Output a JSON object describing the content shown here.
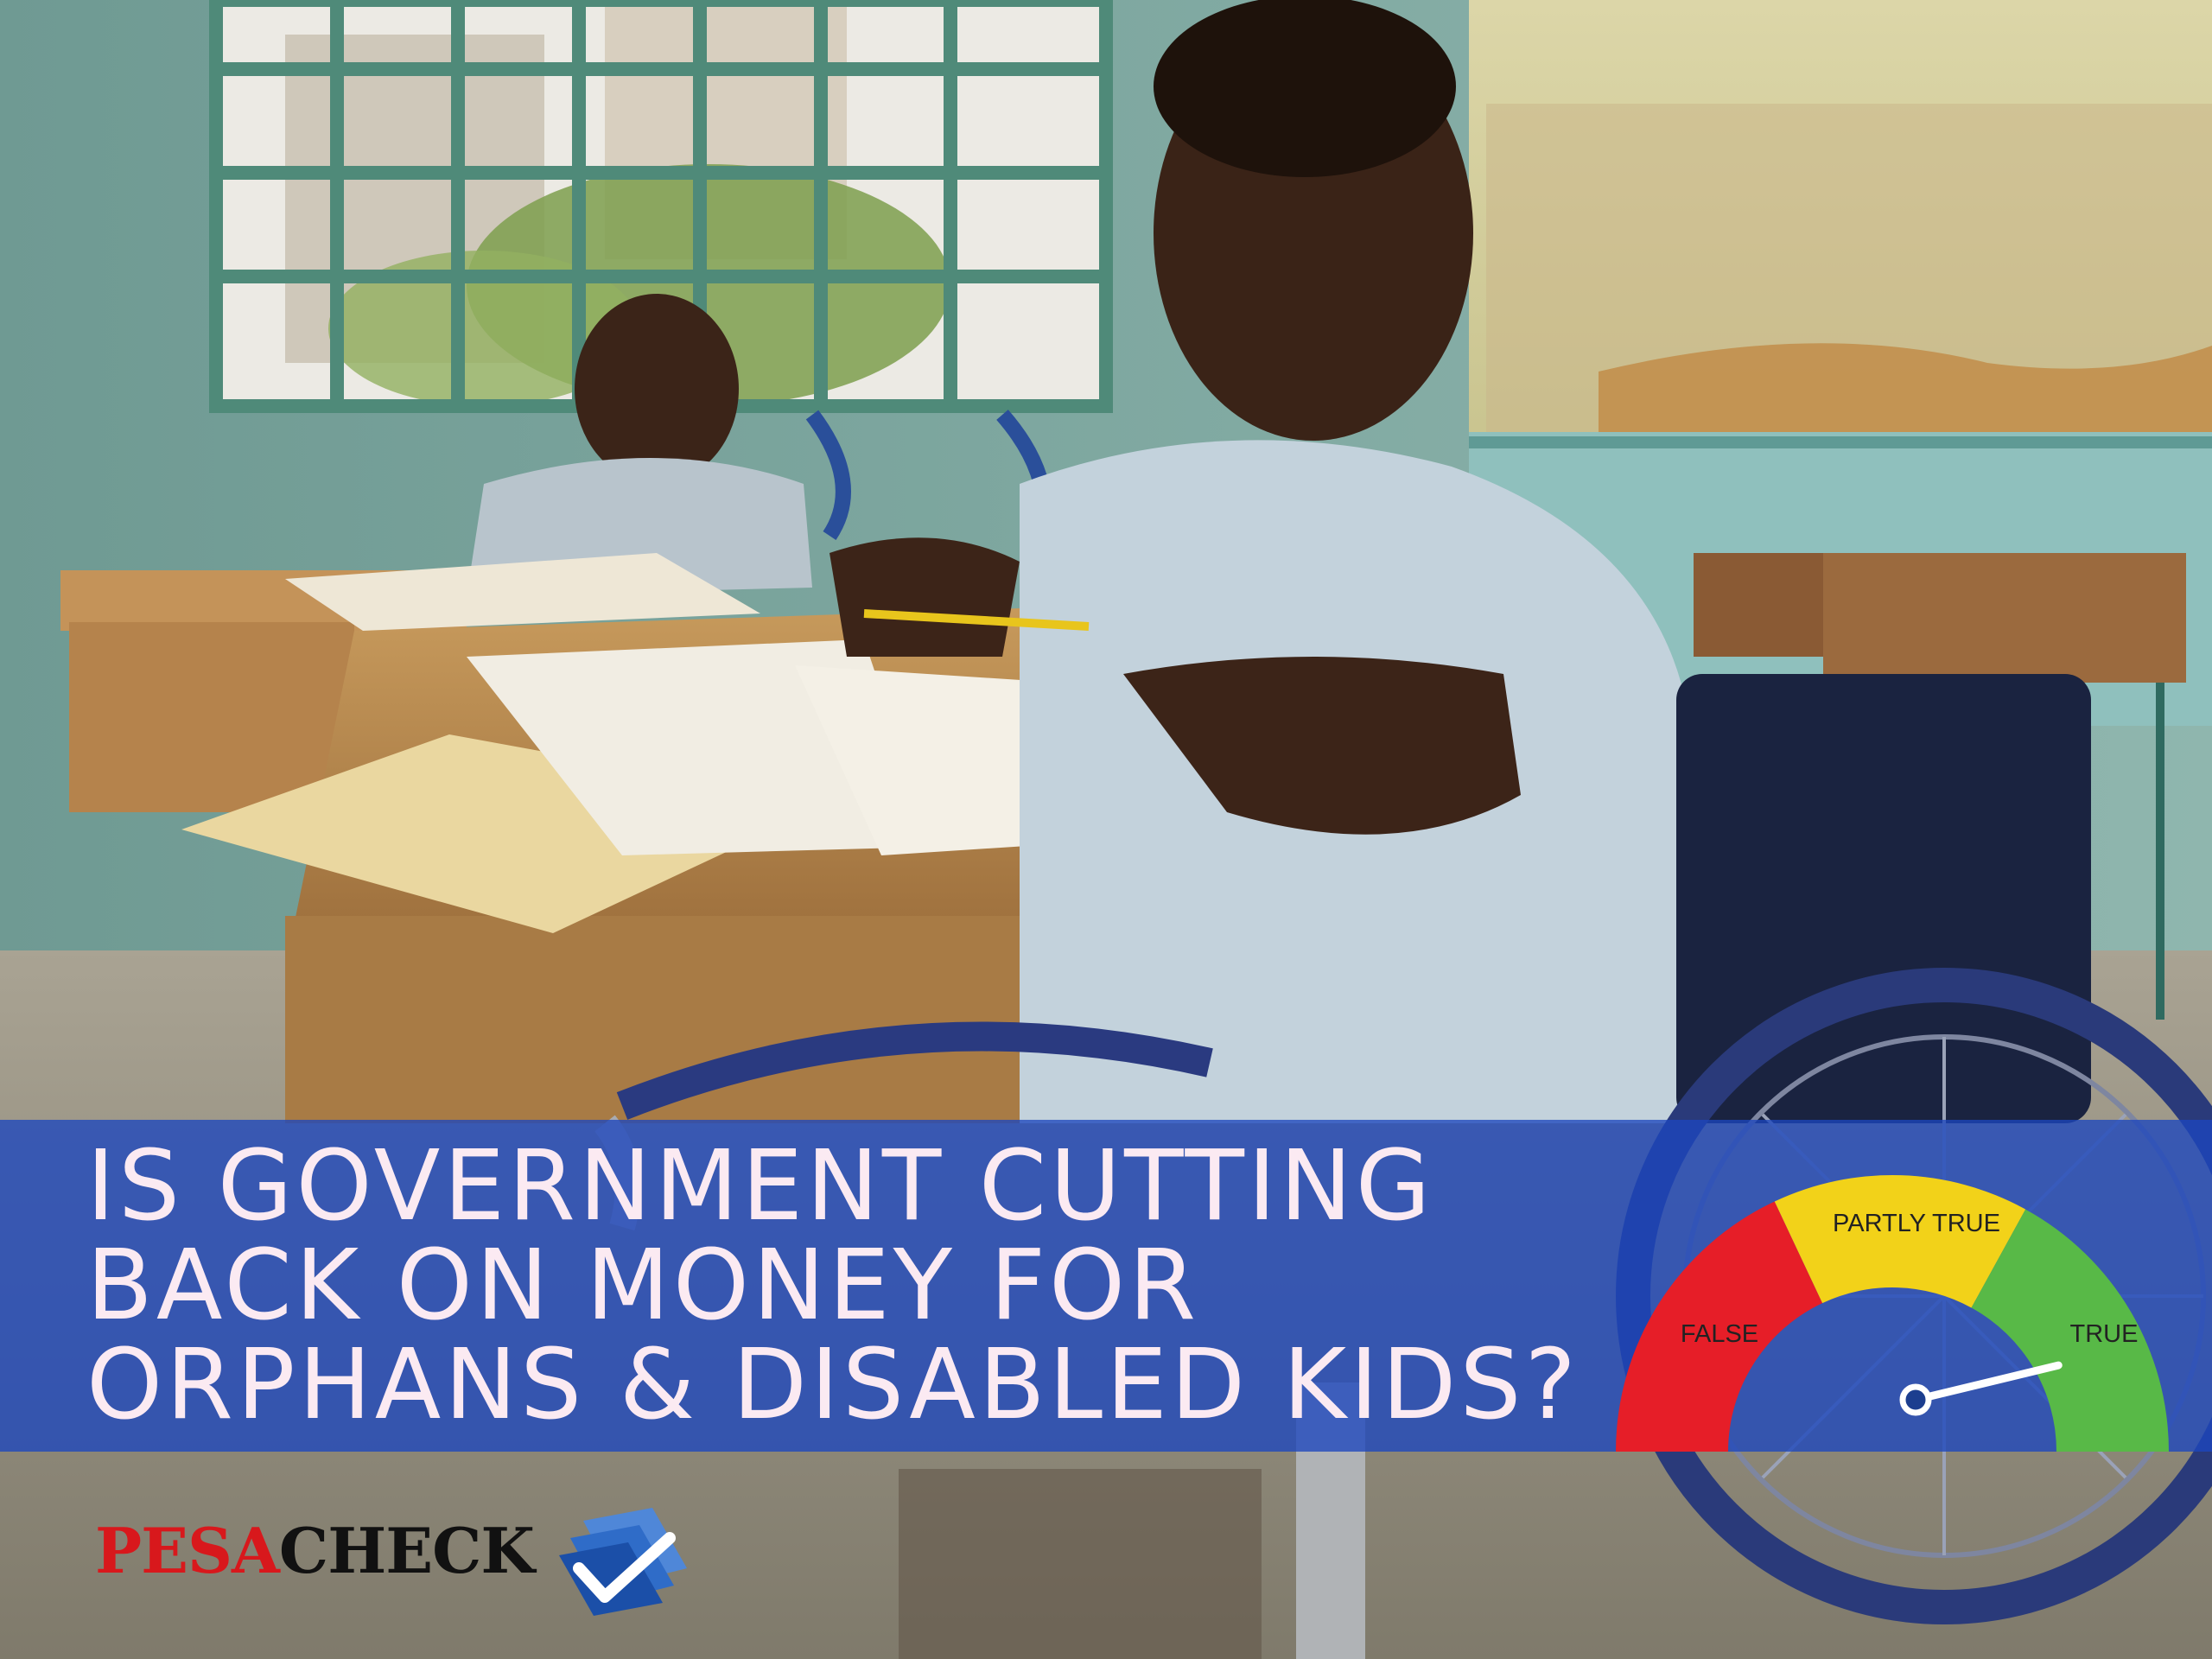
{
  "headline": {
    "lines": [
      "IS GOVERNMENT CUTTING",
      "BACK ON MONEY FOR",
      "ORPHANS & DISABLED KIDS?"
    ]
  },
  "verdict_gauge": {
    "labels": {
      "false": "FALSE",
      "partly_true": "PARTLY TRUE",
      "true": "TRUE"
    },
    "colors": {
      "false": "#e61e28",
      "partly_true": "#f2d219",
      "true": "#58b947"
    },
    "needle_position": 0.95
  },
  "brand": {
    "part1": "PESA",
    "part2": "CHECK",
    "colors": {
      "part1": "#d8181c",
      "part2": "#111111",
      "check": "#1b63c8"
    }
  }
}
